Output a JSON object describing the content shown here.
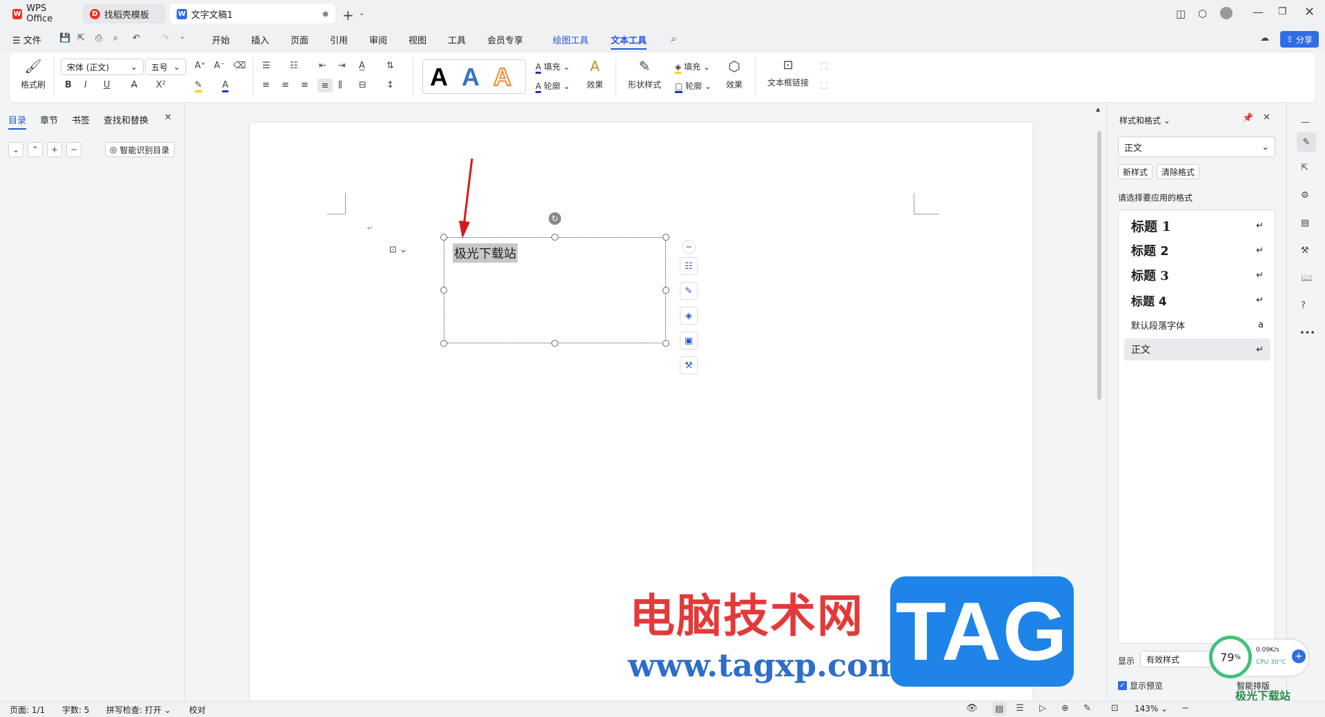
{
  "tabs": [
    {
      "label": "WPS Office",
      "icon": "wps-logo-icon"
    },
    {
      "label": "找稻壳模板",
      "icon": "docer-icon"
    },
    {
      "label": "文字文稿1",
      "icon": "word-doc-icon"
    }
  ],
  "menu": {
    "file": "文件",
    "items": [
      "开始",
      "插入",
      "页面",
      "引用",
      "审阅",
      "视图",
      "工具",
      "会员专享"
    ],
    "drawing_tools": "绘图工具",
    "text_tools": "文本工具",
    "share": "分享"
  },
  "ribbon": {
    "format_painter": "格式刷",
    "font_name": "宋体 (正文)",
    "font_size": "五号",
    "fill": "填充",
    "outline": "轮廓",
    "effects": "效果",
    "shape_style": "形状样式",
    "shape_fill": "填充",
    "shape_outline": "轮廓",
    "shape_effects": "效果",
    "textbox_link": "文本框链接"
  },
  "left_panel": {
    "tabs": [
      "目录",
      "章节",
      "书签",
      "查找和替换"
    ],
    "smart_toc": "智能识别目录"
  },
  "document": {
    "textbox_text": "极光下载站"
  },
  "right_panel": {
    "title": "样式和格式",
    "current_style": "正文",
    "new_style": "新样式",
    "clear_format": "清除格式",
    "prompt": "请选择要应用的格式",
    "styles": [
      "标题 1",
      "标题 2",
      "标题 3",
      "标题 4",
      "默认段落字体",
      "正文"
    ],
    "show_label": "显示",
    "show_value": "有效样式",
    "preview_label": "显示预览",
    "smart_layout": "智能排版"
  },
  "status": {
    "page": "页面: 1/1",
    "words": "字数: 5",
    "spell": "拼写检查: 打开",
    "proof": "校对",
    "zoom": "143%"
  },
  "monitor": {
    "percent": "79",
    "net": "0.09K/s",
    "cpu": "CPU 30°C"
  },
  "watermark": {
    "cn": "电脑技术网",
    "url": "www.tagxp.com",
    "tag": "TAG",
    "site2": "极光下载站"
  },
  "colors": {
    "accent": "#2656d6",
    "arrow": "#d9161b"
  }
}
